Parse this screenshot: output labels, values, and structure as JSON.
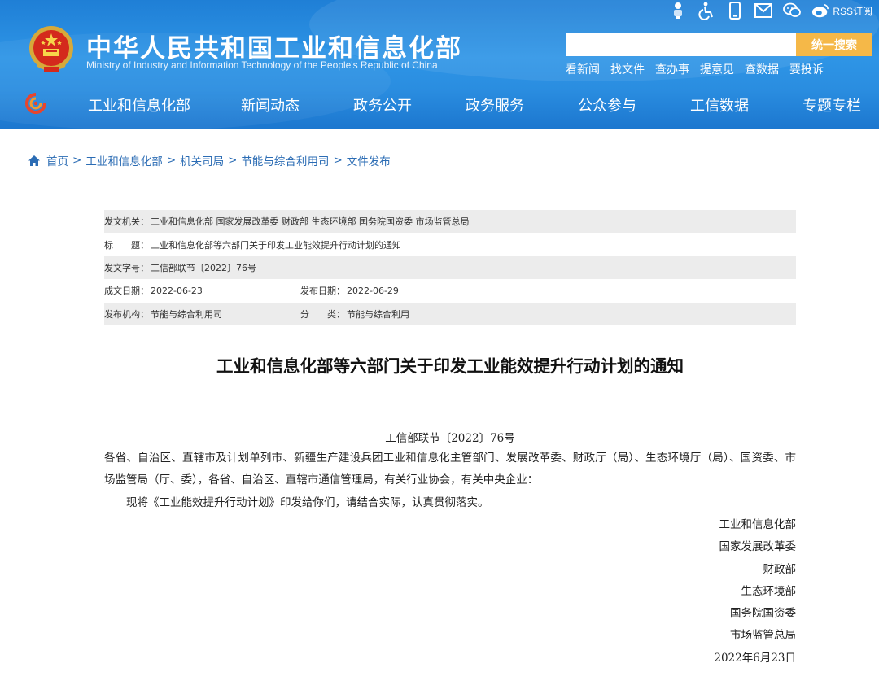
{
  "header": {
    "site_title": "中华人民共和国工业和信息化部",
    "site_subtitle": "Ministry of Industry and Information Technology of the People's Republic of China",
    "top_icons": [
      "robot-icon",
      "accessibility-icon",
      "mobile-icon",
      "mail-icon",
      "wechat-icon",
      "weibo-icon"
    ],
    "rss_label": "RSS订阅",
    "search": {
      "placeholder": "",
      "button_label": "统一搜索"
    },
    "quick_links": [
      "看新闻",
      "找文件",
      "查办事",
      "提意见",
      "查数据",
      "要投诉"
    ],
    "nav": [
      "工业和信息化部",
      "新闻动态",
      "政务公开",
      "政务服务",
      "公众参与",
      "工信数据",
      "专题专栏"
    ],
    "colors": {
      "header_blue": "#2a8de0",
      "search_button": "#f5b848"
    }
  },
  "breadcrumb": [
    "首页",
    "工业和信息化部",
    "机关司局",
    "节能与综合利用司",
    "文件发布"
  ],
  "meta": {
    "issuer_label": "发文机关：",
    "issuer_value": "工业和信息化部 国家发展改革委 财政部 生态环境部 国务院国资委 市场监管总局",
    "title_label": "标　　题：",
    "title_value": "工业和信息化部等六部门关于印发工业能效提升行动计划的通知",
    "docno_label": "发文字号：",
    "docno_value": "工信部联节〔2022〕76号",
    "written_label": "成文日期：",
    "written_value": "2022-06-23",
    "published_label": "发布日期：",
    "published_value": "2022-06-29",
    "agency_label": "发布机构：",
    "agency_value": "节能与综合利用司",
    "category_label": "分　　类：",
    "category_value": "节能与综合利用"
  },
  "article": {
    "title": "工业和信息化部等六部门关于印发工业能效提升行动计划的通知",
    "doc_number": "工信部联节〔2022〕76号",
    "para1": "各省、自治区、直辖市及计划单列市、新疆生产建设兵团工业和信息化主管部门、发展改革委、财政厅（局）、生态环境厅（局）、国资委、市场监管局（厅、委），各省、自治区、直辖市通信管理局，有关行业协会，有关中央企业：",
    "para2": "现将《工业能效提升行动计划》印发给你们，请结合实际，认真贯彻落实。",
    "signatures": [
      "工业和信息化部",
      "国家发展改革委",
      "财政部",
      "生态环境部",
      "国务院国资委",
      "市场监管总局"
    ],
    "date": "2022年6月23日"
  }
}
